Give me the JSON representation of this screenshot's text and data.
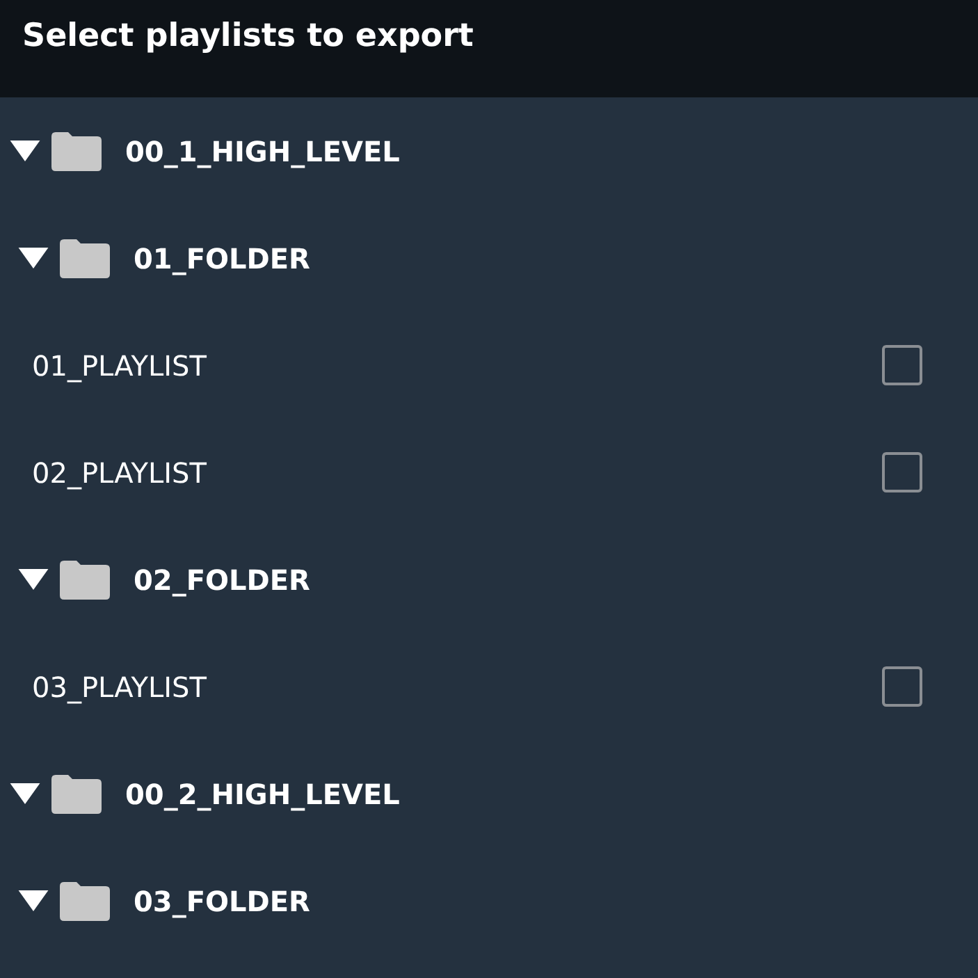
{
  "header": {
    "title": "Select playlists to export"
  },
  "tree": [
    {
      "kind": "folder",
      "label": "00_1_HIGH_LEVEL",
      "expanded": true,
      "children": [
        {
          "kind": "folder",
          "label": "01_FOLDER",
          "expanded": true,
          "children": [
            {
              "kind": "playlist",
              "label": "01_PLAYLIST",
              "checked": false
            },
            {
              "kind": "playlist",
              "label": "02_PLAYLIST",
              "checked": false
            }
          ]
        },
        {
          "kind": "folder",
          "label": "02_FOLDER",
          "expanded": true,
          "children": [
            {
              "kind": "playlist",
              "label": "03_PLAYLIST",
              "checked": false
            }
          ]
        }
      ]
    },
    {
      "kind": "folder",
      "label": "00_2_HIGH_LEVEL",
      "expanded": true,
      "children": [
        {
          "kind": "folder",
          "label": "03_FOLDER",
          "expanded": true
        }
      ]
    }
  ]
}
